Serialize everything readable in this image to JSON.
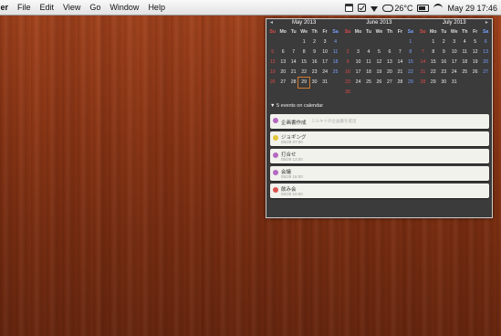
{
  "menubar": {
    "app_name": "ler",
    "items": [
      "File",
      "Edit",
      "View",
      "Go",
      "Window",
      "Help"
    ],
    "temperature": "26°C",
    "clock": "May 29  17:46"
  },
  "calendar": {
    "dow": [
      "Su",
      "Mo",
      "Tu",
      "We",
      "Th",
      "Fr",
      "Sa"
    ],
    "months": [
      {
        "title": "May 2013",
        "days": [
          "",
          "",
          "",
          "1",
          "2",
          "3",
          "4",
          "5",
          "6",
          "7",
          "8",
          "9",
          "10",
          "11",
          "12",
          "13",
          "14",
          "15",
          "16",
          "17",
          "18",
          "19",
          "20",
          "21",
          "22",
          "23",
          "24",
          "25",
          "26",
          "27",
          "28",
          "29",
          "30",
          "31"
        ],
        "today": "29"
      },
      {
        "title": "June 2013",
        "days": [
          "",
          "",
          "",
          "",
          "",
          "",
          "1",
          "2",
          "3",
          "4",
          "5",
          "6",
          "7",
          "8",
          "9",
          "10",
          "11",
          "12",
          "13",
          "14",
          "15",
          "16",
          "17",
          "18",
          "19",
          "20",
          "21",
          "22",
          "23",
          "24",
          "25",
          "26",
          "27",
          "28",
          "29",
          "30"
        ]
      },
      {
        "title": "July 2013",
        "days": [
          "",
          "1",
          "2",
          "3",
          "4",
          "5",
          "6",
          "7",
          "8",
          "9",
          "10",
          "11",
          "12",
          "13",
          "14",
          "15",
          "16",
          "17",
          "18",
          "19",
          "20",
          "21",
          "22",
          "23",
          "24",
          "25",
          "26",
          "27",
          "28",
          "29",
          "30",
          "31"
        ]
      }
    ]
  },
  "events_header": "5 events on calendar",
  "events": [
    {
      "title": "企画書作成",
      "note": "ミルキドの企画書を提出",
      "time": "",
      "color": "#b36ac0"
    },
    {
      "title": "ジョギング",
      "note": "",
      "time": "05/29 07:00",
      "color": "#e0c53a"
    },
    {
      "title": "打合せ",
      "note": "",
      "time": "05/29 13:00",
      "color": "#b36ac0"
    },
    {
      "title": "会議",
      "note": "",
      "time": "05/29 16:00",
      "color": "#b36ac0"
    },
    {
      "title": "飲み会",
      "note": "",
      "time": "05/29 19:00",
      "color": "#d9534f"
    }
  ]
}
